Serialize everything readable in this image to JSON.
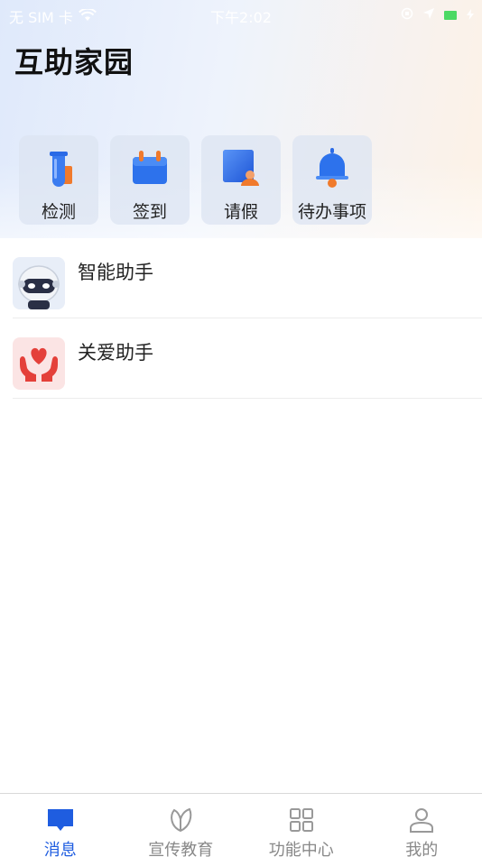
{
  "status_bar": {
    "carrier": "无 SIM 卡",
    "time": "下午2:02",
    "icons": [
      "wifi-icon",
      "orientation-lock-icon",
      "location-icon",
      "battery-icon",
      "charging-icon"
    ],
    "battery_color": "#4cd964"
  },
  "header": {
    "title": "互助家园"
  },
  "quick_actions": [
    {
      "label": "检测",
      "icon": "test-tube-icon"
    },
    {
      "label": "签到",
      "icon": "calendar-icon"
    },
    {
      "label": "请假",
      "icon": "leave-form-icon"
    },
    {
      "label": "待办事项",
      "icon": "bell-icon"
    }
  ],
  "messages": [
    {
      "name": "智能助手",
      "icon": "robot-avatar"
    },
    {
      "name": "关爱助手",
      "icon": "care-hands-avatar"
    }
  ],
  "tab_bar": {
    "active_color": "#1f5de0",
    "inactive_color": "#888888",
    "tabs": [
      {
        "label": "消息",
        "icon": "message-icon",
        "active": true
      },
      {
        "label": "宣传教育",
        "icon": "leaf-icon",
        "active": false
      },
      {
        "label": "功能中心",
        "icon": "grid-icon",
        "active": false
      },
      {
        "label": "我的",
        "icon": "person-icon",
        "active": false
      }
    ]
  }
}
